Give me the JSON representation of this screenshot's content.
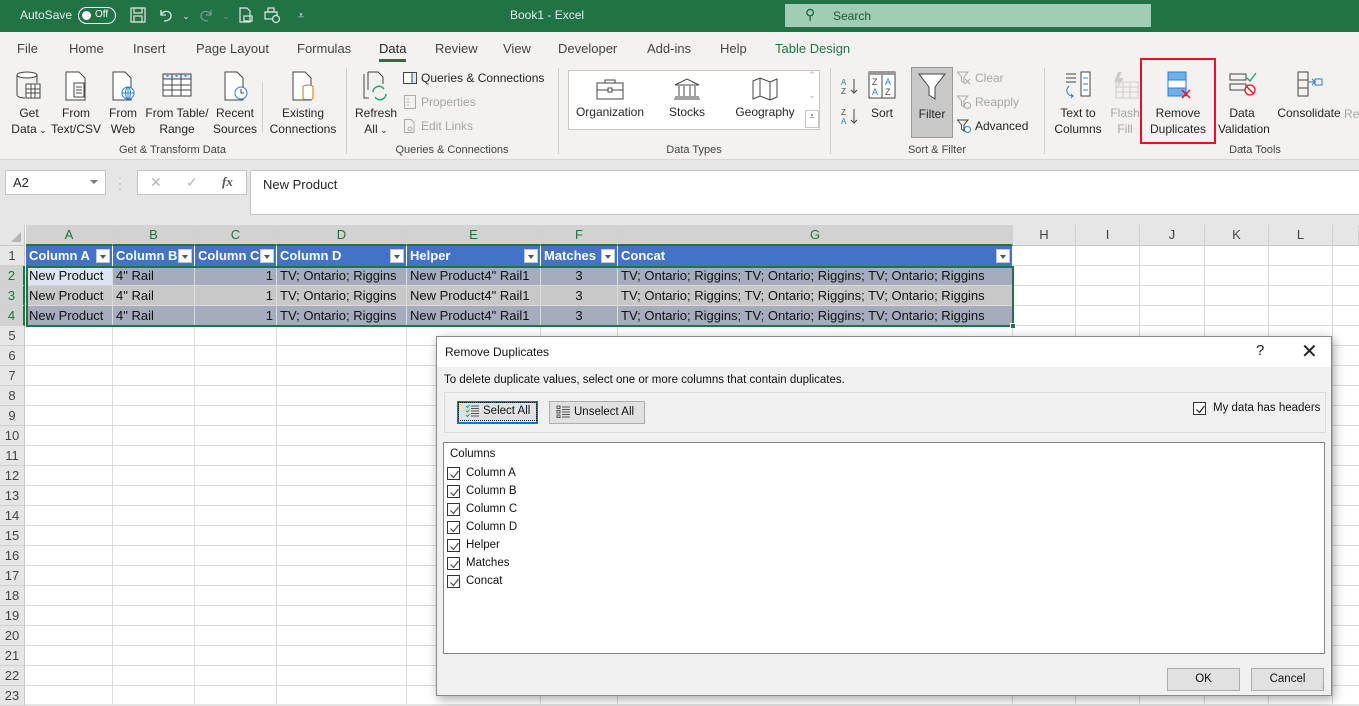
{
  "titlebar": {
    "autosave_label": "AutoSave",
    "autosave_state": "Off",
    "window_title": "Book1  -  Excel",
    "search_placeholder": "Search",
    "qat_icons": [
      "save-icon",
      "undo-icon",
      "redo-icon",
      "print-preview-icon",
      "quick-print-icon",
      "customize-qat-icon"
    ]
  },
  "tabs": [
    {
      "label": "File"
    },
    {
      "label": "Home"
    },
    {
      "label": "Insert"
    },
    {
      "label": "Page Layout"
    },
    {
      "label": "Formulas"
    },
    {
      "label": "Data",
      "active": true
    },
    {
      "label": "Review"
    },
    {
      "label": "View"
    },
    {
      "label": "Developer"
    },
    {
      "label": "Add-ins"
    },
    {
      "label": "Help"
    },
    {
      "label": "Table Design"
    }
  ],
  "ribbon": {
    "get_transform": {
      "group_label": "Get & Transform Data",
      "get_data_1": "Get",
      "get_data_2": "Data",
      "from_text_1": "From",
      "from_text_2": "Text/CSV",
      "from_web_1": "From",
      "from_web_2": "Web",
      "from_table_1": "From Table/",
      "from_table_2": "Range",
      "recent_1": "Recent",
      "recent_2": "Sources",
      "existing_1": "Existing",
      "existing_2": "Connections"
    },
    "queries": {
      "group_label": "Queries & Connections",
      "refresh_1": "Refresh",
      "refresh_2": "All",
      "queries_connections": "Queries & Connections",
      "properties": "Properties",
      "edit_links": "Edit Links"
    },
    "data_types": {
      "group_label": "Data Types",
      "items": [
        "Organization",
        "Stocks",
        "Geography"
      ]
    },
    "sort_filter": {
      "group_label": "Sort & Filter",
      "sort": "Sort",
      "filter": "Filter",
      "clear": "Clear",
      "reapply": "Reapply",
      "advanced": "Advanced"
    },
    "data_tools": {
      "group_label": "Data Tools",
      "text_to_columns_1": "Text to",
      "text_to_columns_2": "Columns",
      "flash_fill_1": "Flash",
      "flash_fill_2": "Fill",
      "remove_dup_1": "Remove",
      "remove_dup_2": "Duplicates",
      "data_validation_1": "Data",
      "data_validation_2": "Validation",
      "consolidate": "Consolidate",
      "relationships_partial": "Re"
    },
    "highlight_color": "#e81123"
  },
  "formula_bar": {
    "name_box": "A2",
    "formula": "New Product"
  },
  "sheet": {
    "columns": [
      "A",
      "B",
      "C",
      "D",
      "E",
      "F",
      "G",
      "H",
      "I",
      "J",
      "K",
      "L"
    ],
    "rows": [
      "1",
      "2",
      "3",
      "4",
      "5",
      "6",
      "7",
      "8",
      "9",
      "10",
      "11",
      "12",
      "13",
      "14",
      "15",
      "16",
      "17",
      "18",
      "19",
      "20",
      "21",
      "22",
      "23"
    ],
    "table_headers": [
      "Column A",
      "Column B",
      "Column C",
      "Column D",
      "Helper",
      "Matches",
      "Concat"
    ],
    "table_rows": [
      [
        "New Product",
        "4\" Rail",
        "1",
        "TV; Ontario; Riggins",
        "New Product4\" Rail1",
        "3",
        "TV; Ontario; Riggins; TV; Ontario; Riggins; TV; Ontario; Riggins"
      ],
      [
        "New Product",
        "4\" Rail",
        "1",
        "TV; Ontario; Riggins",
        "New Product4\" Rail1",
        "3",
        "TV; Ontario; Riggins; TV; Ontario; Riggins; TV; Ontario; Riggins"
      ],
      [
        "New Product",
        "4\" Rail",
        "1",
        "TV; Ontario; Riggins",
        "New Product4\" Rail1",
        "3",
        "TV; Ontario; Riggins; TV; Ontario; Riggins; TV; Ontario; Riggins"
      ]
    ],
    "header_color": "#4472c4"
  },
  "dialog": {
    "title": "Remove Duplicates",
    "help": "?",
    "instruction": "To delete duplicate values, select one or more columns that contain duplicates.",
    "select_all": "Select All",
    "unselect_all": "Unselect All",
    "headers_checkbox": {
      "label": "My data has headers",
      "checked": true
    },
    "columns_header": "Columns",
    "columns": [
      {
        "label": "Column A",
        "checked": true
      },
      {
        "label": "Column B",
        "checked": true
      },
      {
        "label": "Column C",
        "checked": true
      },
      {
        "label": "Column D",
        "checked": true
      },
      {
        "label": "Helper",
        "checked": true
      },
      {
        "label": "Matches",
        "checked": true
      },
      {
        "label": "Concat",
        "checked": true
      }
    ],
    "ok": "OK",
    "cancel": "Cancel"
  }
}
